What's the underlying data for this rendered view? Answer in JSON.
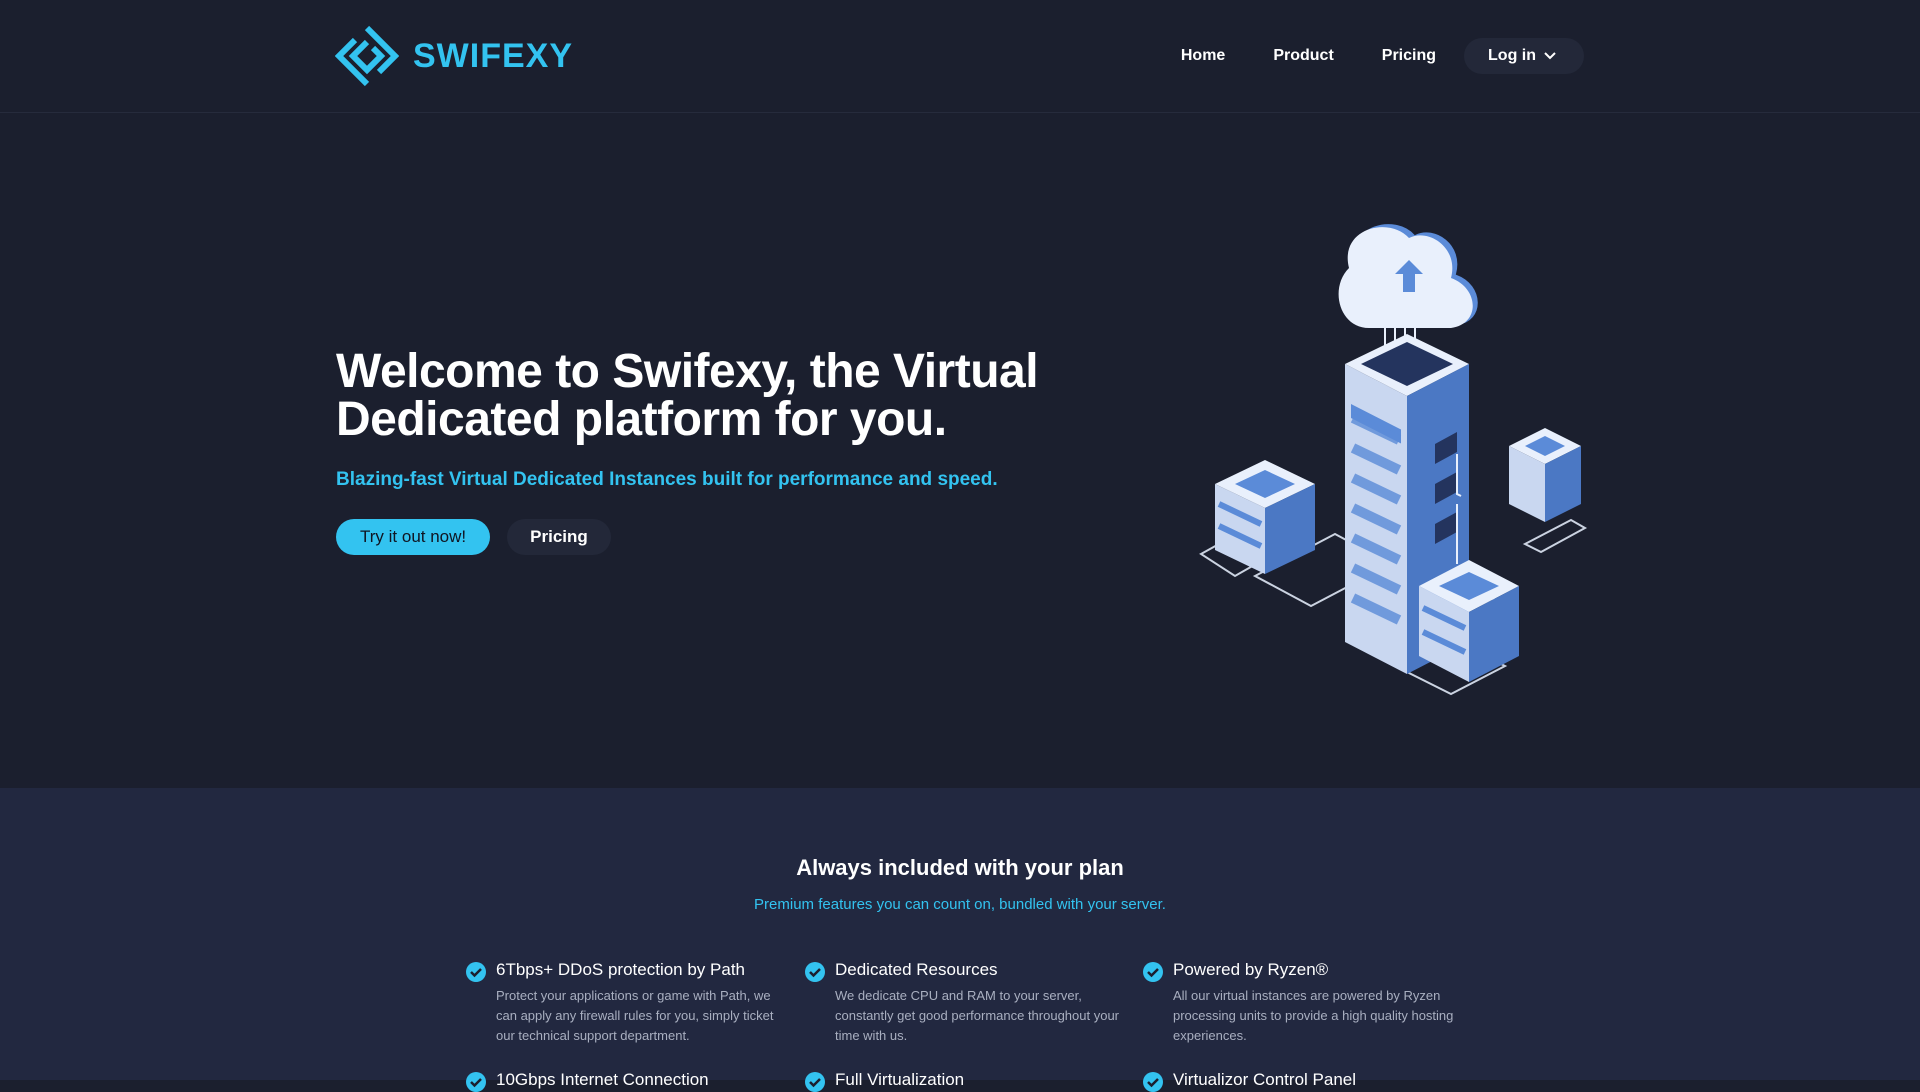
{
  "brand": {
    "name": "SWIFEXY",
    "accent_color": "#33c3f0",
    "logo_icon": "swifexy-diamond-logo-icon"
  },
  "nav": {
    "home": "Home",
    "product": "Product",
    "pricing": "Pricing",
    "login": "Log in",
    "login_icon": "chevron-down-icon"
  },
  "hero": {
    "title": "Welcome to Swifexy, the Virtual Dedicated platform for you.",
    "subtitle": "Blazing-fast Virtual Dedicated Instances built for performance and speed.",
    "cta_primary": "Try it out now!",
    "cta_secondary": "Pricing",
    "illustration": "isometric-cloud-servers-illustration"
  },
  "features": {
    "title": "Always included with your plan",
    "subtitle": "Premium features you can count on, bundled with your server.",
    "items": [
      {
        "title": "6Tbps+ DDoS protection by Path",
        "desc": "Protect your applications or game with Path, we can apply any firewall rules for you, simply ticket our technical support department.",
        "icon": "check-circle-icon"
      },
      {
        "title": "Dedicated Resources",
        "desc": "We dedicate CPU and RAM to your server, constantly get good performance throughout your time with us.",
        "icon": "check-circle-icon"
      },
      {
        "title": "Powered by Ryzen®",
        "desc": "All our virtual instances are powered by Ryzen processing units to provide a high quality hosting experiences.",
        "icon": "check-circle-icon"
      },
      {
        "title": "10Gbps Internet Connection",
        "desc": "",
        "icon": "check-circle-icon"
      },
      {
        "title": "Full Virtualization",
        "desc": "",
        "icon": "check-circle-icon"
      },
      {
        "title": "Virtualizor Control Panel",
        "desc": "",
        "icon": "check-circle-icon"
      }
    ]
  }
}
